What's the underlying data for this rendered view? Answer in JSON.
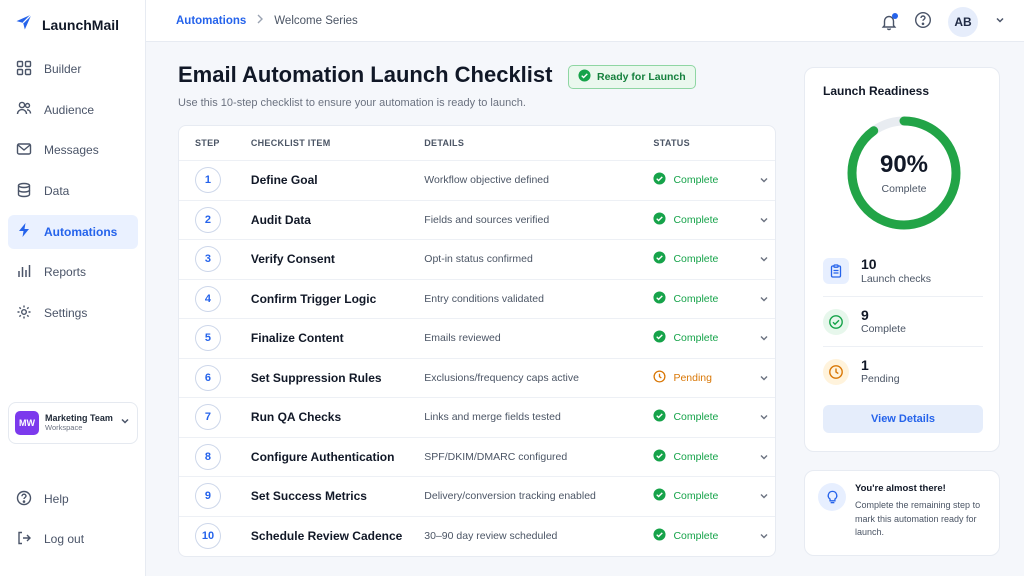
{
  "app": {
    "name": "LaunchMail"
  },
  "sidebar": {
    "items": [
      {
        "label": "Builder",
        "icon": "grid-icon"
      },
      {
        "label": "Audience",
        "icon": "users-icon"
      },
      {
        "label": "Messages",
        "icon": "mail-icon"
      },
      {
        "label": "Data",
        "icon": "database-icon"
      },
      {
        "label": "Automations",
        "icon": "bolt-icon",
        "active": true
      },
      {
        "label": "Reports",
        "icon": "bar-chart-icon"
      },
      {
        "label": "Settings",
        "icon": "gear-icon"
      }
    ],
    "workspace": {
      "initials": "MW",
      "name": "Marketing Team",
      "sub": "Workspace"
    },
    "bottom": [
      {
        "label": "Help",
        "icon": "help-icon"
      },
      {
        "label": "Log out",
        "icon": "logout-icon"
      }
    ]
  },
  "topbar": {
    "breadcrumb_root": "Automations",
    "breadcrumb_current": "Welcome Series",
    "avatar_initials": "AB"
  },
  "page": {
    "title": "Email Automation Launch Checklist",
    "badge": "Ready for Launch",
    "subtitle": "Use this 10-step checklist to ensure your automation is ready to launch."
  },
  "table": {
    "headers": {
      "step": "STEP",
      "item": "CHECKLIST ITEM",
      "details": "DETAILS",
      "status": "STATUS"
    },
    "rows": [
      {
        "step": "1",
        "item": "Define Goal",
        "details": "Workflow objective defined",
        "status": "Complete"
      },
      {
        "step": "2",
        "item": "Audit Data",
        "details": "Fields and sources verified",
        "status": "Complete"
      },
      {
        "step": "3",
        "item": "Verify Consent",
        "details": "Opt-in status confirmed",
        "status": "Complete"
      },
      {
        "step": "4",
        "item": "Confirm Trigger Logic",
        "details": "Entry conditions validated",
        "status": "Complete"
      },
      {
        "step": "5",
        "item": "Finalize Content",
        "details": "Emails reviewed",
        "status": "Complete"
      },
      {
        "step": "6",
        "item": "Set Suppression Rules",
        "details": "Exclusions/frequency caps active",
        "status": "Pending"
      },
      {
        "step": "7",
        "item": "Run QA Checks",
        "details": "Links and merge fields tested",
        "status": "Complete"
      },
      {
        "step": "8",
        "item": "Configure Authentication",
        "details": "SPF/DKIM/DMARC configured",
        "status": "Complete"
      },
      {
        "step": "9",
        "item": "Set Success Metrics",
        "details": "Delivery/conversion tracking enabled",
        "status": "Complete"
      },
      {
        "step": "10",
        "item": "Schedule Review Cadence",
        "details": "30–90 day review scheduled",
        "status": "Complete"
      }
    ]
  },
  "readiness": {
    "title": "Launch Readiness",
    "percent_label": "90%",
    "percent_value": 90,
    "percent_caption": "Complete",
    "stats": [
      {
        "value": "10",
        "label": "Launch checks",
        "icon": "clipboard-icon"
      },
      {
        "value": "9",
        "label": "Complete",
        "icon": "check-circle-icon"
      },
      {
        "value": "1",
        "label": "Pending",
        "icon": "clock-icon"
      }
    ],
    "button": "View Details"
  },
  "tip": {
    "title": "You're almost there!",
    "body": "Complete the remaining step to mark this automation ready for launch."
  },
  "colors": {
    "accent": "#2563eb",
    "success": "#16a34a",
    "pending": "#d97706",
    "workspace": "#7c3aed"
  }
}
